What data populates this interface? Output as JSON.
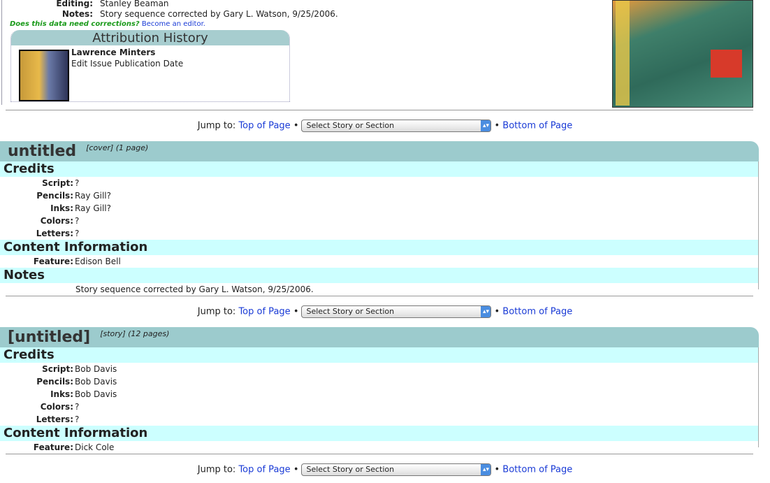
{
  "issue": {
    "editing_label": "Editing:",
    "editing": "Stanley Beaman",
    "notes_label": "Notes:",
    "notes": "Story sequence corrected by Gary L. Watson, 9/25/2006."
  },
  "corrections": {
    "question": "Does this data need corrections?",
    "link": "Become an editor."
  },
  "attribution": {
    "title": "Attribution History",
    "user": "Lawrence Minters",
    "action": "Edit Issue Publication Date"
  },
  "jump": {
    "label": "Jump to:",
    "top": "Top of Page",
    "select": "Select Story or Section",
    "bottom": "Bottom of Page",
    "sep": "•"
  },
  "stories": [
    {
      "title": "untitled",
      "type": "[cover] (1 page)",
      "credits_title": "Credits",
      "credits": [
        {
          "label": "Script:",
          "value": "?"
        },
        {
          "label": "Pencils:",
          "value": "Ray Gill?"
        },
        {
          "label": "Inks:",
          "value": "Ray Gill?"
        },
        {
          "label": "Colors:",
          "value": "?"
        },
        {
          "label": "Letters:",
          "value": "?"
        }
      ],
      "content_title": "Content Information",
      "feature_label": "Feature:",
      "feature": "Edison Bell",
      "notes_title": "Notes",
      "notes": "Story sequence corrected by Gary L. Watson, 9/25/2006."
    },
    {
      "title": "[untitled]",
      "type": "[story] (12 pages)",
      "credits_title": "Credits",
      "credits": [
        {
          "label": "Script:",
          "value": "Bob Davis"
        },
        {
          "label": "Pencils:",
          "value": "Bob Davis"
        },
        {
          "label": "Inks:",
          "value": "Bob Davis"
        },
        {
          "label": "Colors:",
          "value": "?"
        },
        {
          "label": "Letters:",
          "value": "?"
        }
      ],
      "content_title": "Content Information",
      "feature_label": "Feature:",
      "feature": "Dick Cole"
    }
  ]
}
